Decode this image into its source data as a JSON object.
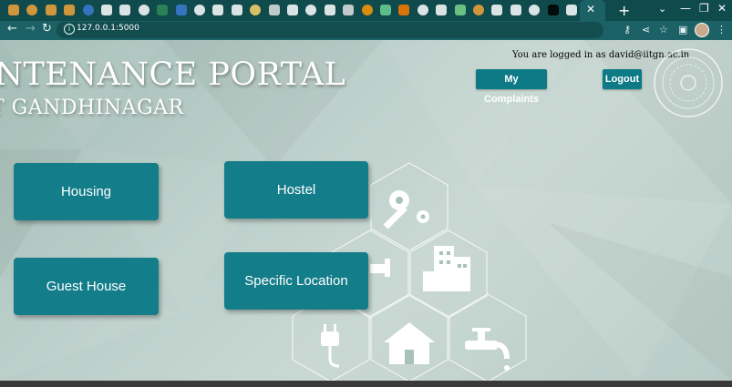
{
  "browser": {
    "url": "127.0.0.1:5000",
    "tab_colors": [
      "#f2a33a",
      "#f2a33a",
      "#f2a33a",
      "#f2a33a",
      "#3b7bd4",
      "#ffffff",
      "#ffffff",
      "#ffffff",
      "#2e8b57",
      "#3b7bd4",
      "#ffffff",
      "#ffffff",
      "#ffffff",
      "#ffd36a",
      "#e0e0e0",
      "#ffffff",
      "#ffffff",
      "#ffffff",
      "#e0e0e0",
      "#ff9800",
      "#6fcf97",
      "#ff7a00",
      "#ffffff",
      "#ffffff",
      "#7bd389",
      "#f2a33a",
      "#ffffff",
      "#ffffff",
      "#ffffff",
      "#000000",
      "#ffffff"
    ],
    "active_tab_close": "✕",
    "new_tab": "+",
    "window_controls": {
      "minimize": "—",
      "maximize": "❐",
      "close": "✕"
    }
  },
  "header": {
    "title": "INTENANCE PORTAL",
    "subtitle": "T GANDHINAGAR",
    "login_text": "You are logged in as david@iitgn.ac.in",
    "my_complaints": "My Complaints",
    "logout": "Logout"
  },
  "tiles": {
    "housing": "Housing",
    "hostel": "Hostel",
    "guest_house": "Guest House",
    "specific_location": "Specific Location"
  },
  "colors": {
    "accent": "#147d8a",
    "tab_bar": "#0f4a4d",
    "toolbar": "#1b6165"
  }
}
